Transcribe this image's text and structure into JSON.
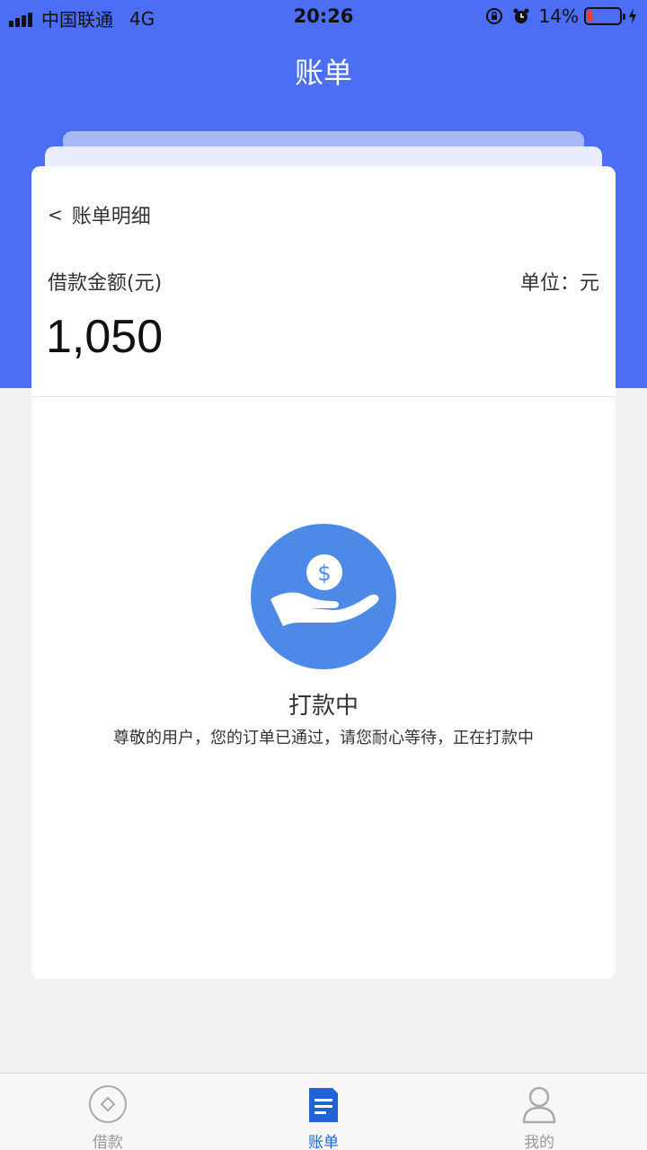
{
  "status_bar": {
    "carrier": "中国联通",
    "network": "4G",
    "time": "20:26",
    "battery_percent": "14%",
    "battery_level": 0.14,
    "icons": [
      "signal-icon",
      "orientation-lock-icon",
      "alarm-icon",
      "battery-icon",
      "charging-icon"
    ]
  },
  "header": {
    "title": "账单"
  },
  "card": {
    "back_label": "账单明细",
    "amount_label": "借款金额(元)",
    "unit_label": "单位：元",
    "amount_value": "1,050"
  },
  "status": {
    "icon": "hand-coin-icon",
    "title": "打款中",
    "description": "尊敬的用户，您的订单已通过，请您耐心等待，正在打款中"
  },
  "tabs": [
    {
      "label": "借款",
      "icon": "loan-icon",
      "active": false
    },
    {
      "label": "账单",
      "icon": "bill-icon",
      "active": true
    },
    {
      "label": "我的",
      "icon": "user-icon",
      "active": false
    }
  ],
  "colors": {
    "primary": "#4b6ef5",
    "active_tab": "#1f63d6",
    "status_circle": "#4d8ae8",
    "background": "#f2f2f2"
  }
}
